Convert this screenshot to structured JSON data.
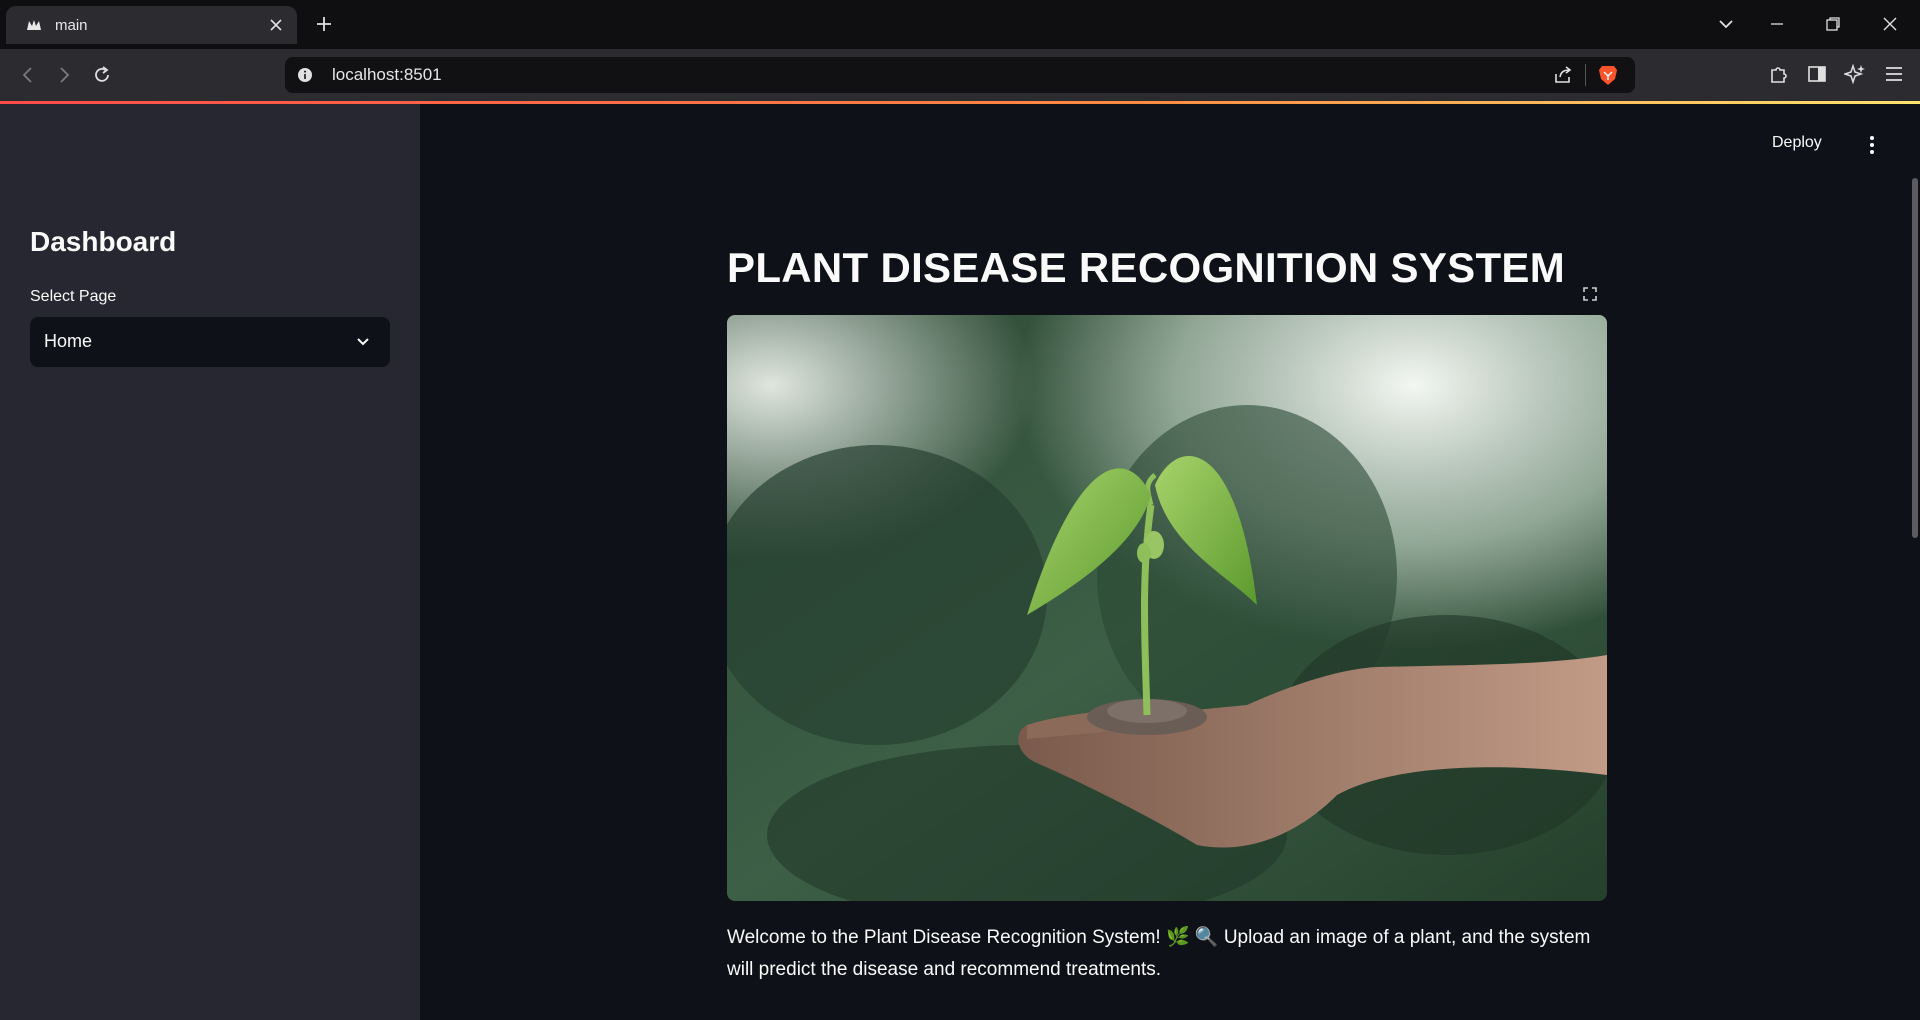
{
  "browser": {
    "tab_title": "main",
    "url": "localhost:8501",
    "icons": {
      "favicon": "streamlit-crown-icon",
      "tab_close": "close-icon",
      "new_tab": "plus-icon",
      "tab_search": "chevron-down-icon",
      "minimize": "minimize-icon",
      "restore": "restore-icon",
      "close_window": "close-icon",
      "back": "back-arrow-icon",
      "forward": "forward-arrow-icon",
      "reload": "reload-icon",
      "site_info": "info-icon",
      "share": "share-icon",
      "shields": "brave-lion-icon",
      "extensions": "puzzle-icon",
      "sidebar": "sidebar-panel-icon",
      "leo": "ai-sparkle-icon",
      "menu": "hamburger-menu-icon"
    },
    "loadbar_colors": [
      "#ff4b4b",
      "#ff8c42",
      "#fde36e"
    ]
  },
  "app": {
    "deploy_label": "Deploy",
    "menu_icon": "vertical-dots-icon",
    "sidebar": {
      "title": "Dashboard",
      "select_label": "Select Page",
      "select_value": "Home"
    },
    "main": {
      "title": "PLANT DISEASE RECOGNITION SYSTEM",
      "image_alt": "seedling in soil held in a hand",
      "fullscreen_icon": "fullscreen-icon",
      "welcome_text": "Welcome to the Plant Disease Recognition System! 🌿 🔍 Upload an image of a plant, and the system will predict the disease and recommend treatments."
    },
    "colors": {
      "background": "#0e1117",
      "sidebar": "#262730",
      "text": "#fafafa"
    }
  }
}
